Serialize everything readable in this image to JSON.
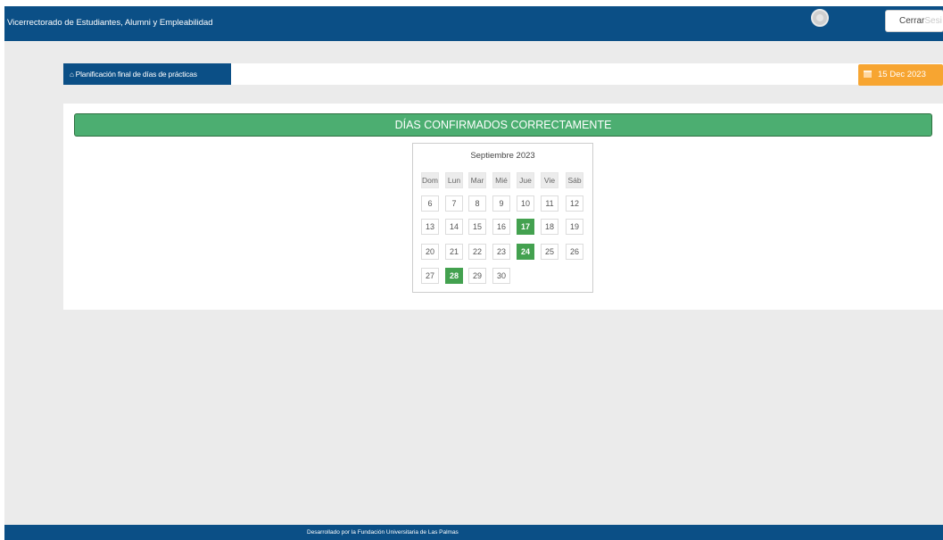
{
  "header": {
    "site_title": "Vicerrectorado de Estudiantes, Alumni y Empleabilidad",
    "logout_label": "Cerrar",
    "logout_label_faded": "Sesi"
  },
  "breadcrumb": {
    "icon": "home-icon",
    "label": "Planificación final de días de prácticas"
  },
  "date_badge": {
    "icon": "calendar-icon",
    "text": "15 Dec 2023"
  },
  "main": {
    "banner_text": "DÍAS CONFIRMADOS CORRECTAMENTE"
  },
  "calendar": {
    "title": "Septiembre 2023",
    "weekdays": [
      "Dom",
      "Lun",
      "Mar",
      "Mié",
      "Jue",
      "Vie",
      "Sáb"
    ],
    "weeks": [
      [
        "6",
        "7",
        "8",
        "9",
        "10",
        "11",
        "12"
      ],
      [
        "13",
        "14",
        "15",
        "16",
        "17",
        "18",
        "19"
      ],
      [
        "20",
        "21",
        "22",
        "23",
        "24",
        "25",
        "26"
      ],
      [
        "27",
        "28",
        "29",
        "30"
      ]
    ],
    "selected_days": [
      "17",
      "24",
      "28"
    ]
  },
  "footer": {
    "credits": "Desarrollado por la Fundación Universitaria de Las Palmas"
  },
  "colors": {
    "primary": "#0b4f86",
    "success": "#4cae71",
    "selected_day": "#43a14f",
    "date_badge": "#f7a531",
    "background": "#ebebeb"
  }
}
